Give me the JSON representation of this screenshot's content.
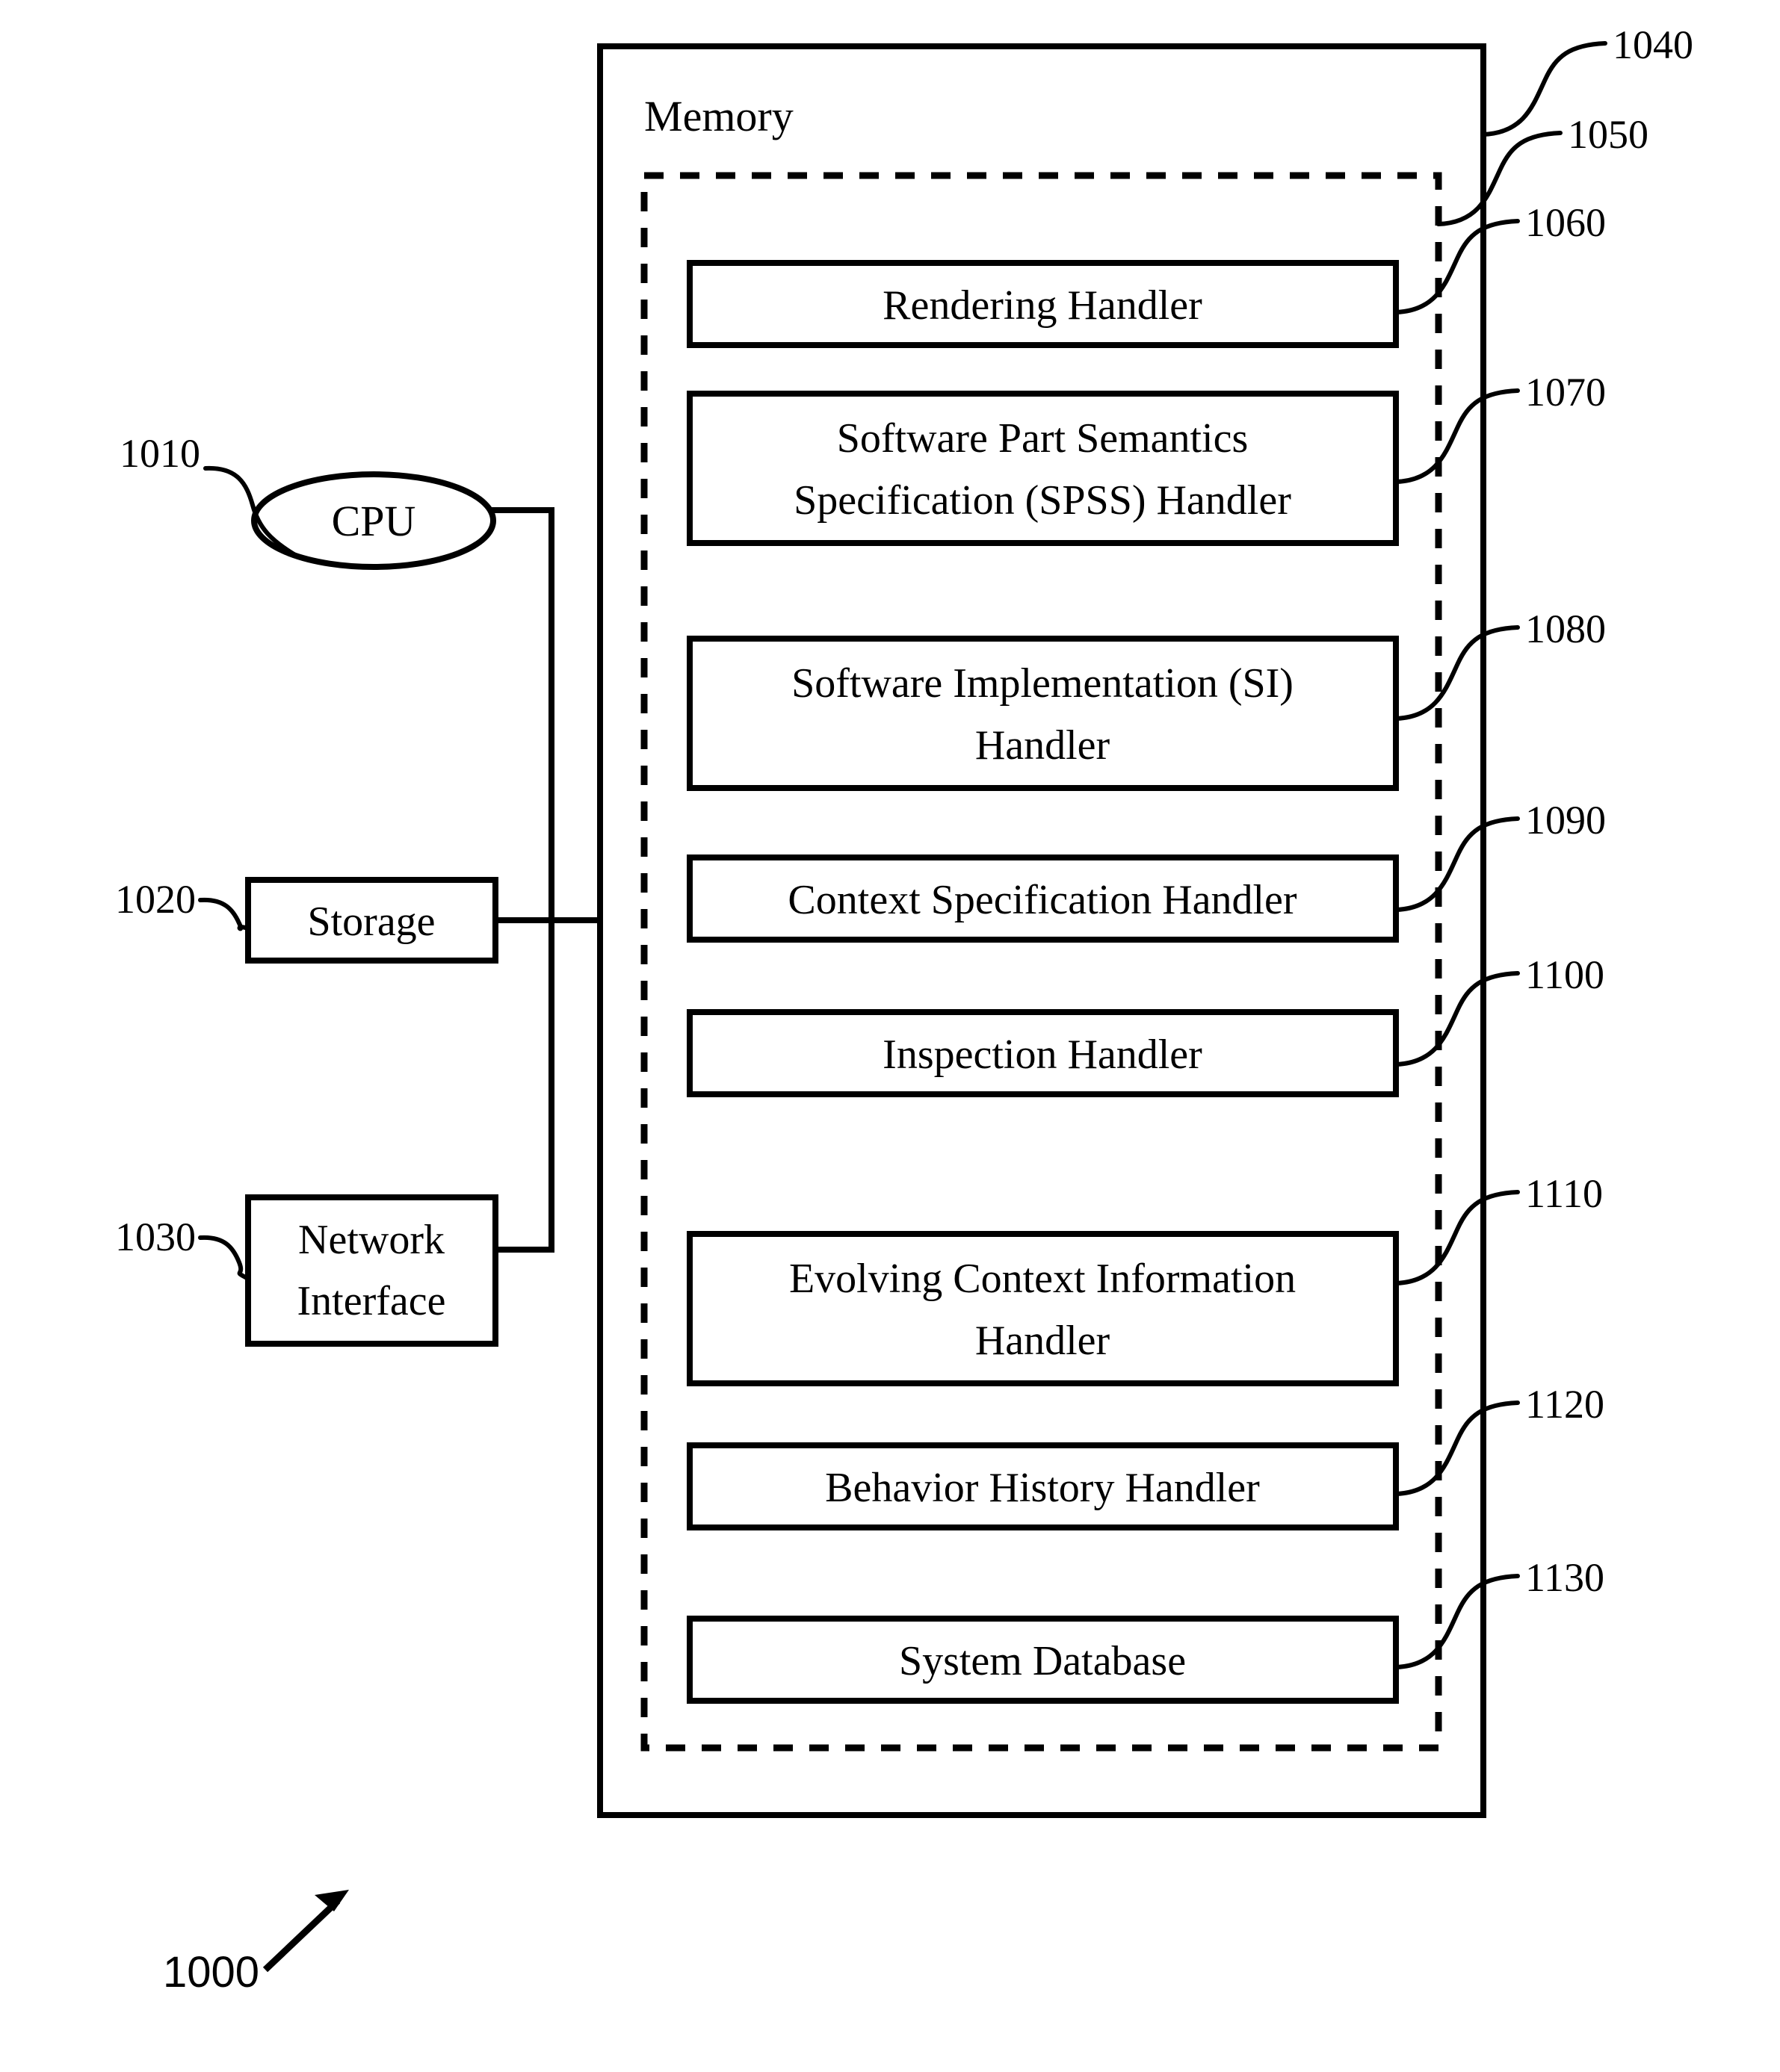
{
  "figure": {
    "reference_number": "1000",
    "memory_title": "Memory"
  },
  "components": {
    "cpu": {
      "label": "CPU",
      "ref": "1010"
    },
    "storage": {
      "label": "Storage",
      "ref": "1020"
    },
    "network_interface": {
      "label_line1": "Network",
      "label_line2": "Interface",
      "ref": "1030"
    }
  },
  "memory_block": {
    "ref": "1040",
    "inner_container_ref": "1050"
  },
  "handlers": [
    {
      "label_line1": "Rendering Handler",
      "label_line2": "",
      "ref": "1060"
    },
    {
      "label_line1": "Software Part Semantics",
      "label_line2": "Specification (SPSS) Handler",
      "ref": "1070"
    },
    {
      "label_line1": "Software Implementation (SI)",
      "label_line2": "Handler",
      "ref": "1080"
    },
    {
      "label_line1": "Context Specification Handler",
      "label_line2": "",
      "ref": "1090"
    },
    {
      "label_line1": "Inspection Handler",
      "label_line2": "",
      "ref": "1100"
    },
    {
      "label_line1": "Evolving Context Information",
      "label_line2": "Handler",
      "ref": "1110"
    },
    {
      "label_line1": "Behavior History Handler",
      "label_line2": "",
      "ref": "1120"
    },
    {
      "label_line1": "System Database",
      "label_line2": "",
      "ref": "1130"
    }
  ],
  "colors": {
    "ink": "#000000",
    "paper": "#ffffff"
  }
}
